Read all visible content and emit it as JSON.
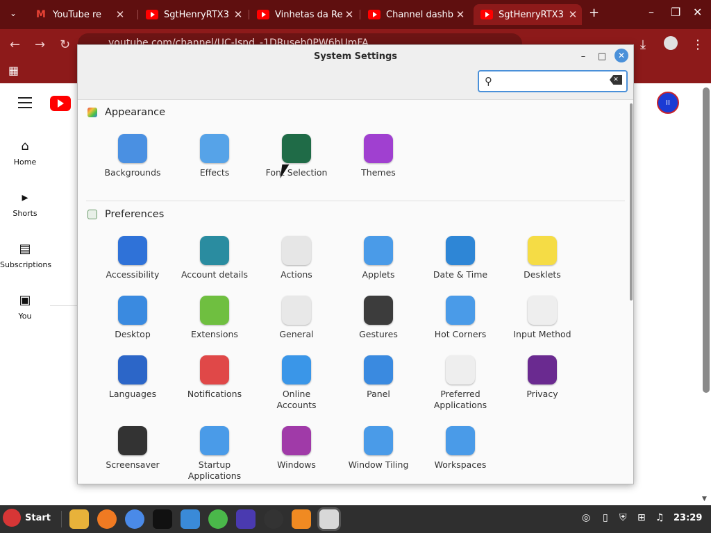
{
  "browser": {
    "tabs": [
      {
        "label": "YouTube re",
        "favicon": "gmail-icon"
      },
      {
        "label": "SgtHenryRTX3",
        "favicon": "youtube-icon"
      },
      {
        "label": "Vinhetas da Re",
        "favicon": "youtube-icon"
      },
      {
        "label": "Channel dashb",
        "favicon": "youtube-icon"
      },
      {
        "label": "SgtHenryRTX3",
        "favicon": "youtube-icon",
        "active": true
      }
    ],
    "address": "youtube.com/channel/UC-Isnd_-1DRuseh0PW6hUmFA"
  },
  "youtube": {
    "nav": [
      {
        "label": "Home",
        "icon": "home-icon"
      },
      {
        "label": "Shorts",
        "icon": "shorts-icon"
      },
      {
        "label": "Subscriptions",
        "icon": "subscriptions-icon"
      },
      {
        "label": "You",
        "icon": "library-icon"
      }
    ]
  },
  "settings": {
    "title": "System Settings",
    "search_value": "",
    "sections": [
      {
        "title": "Appearance",
        "items": [
          {
            "label": "Backgrounds",
            "icon": "backgrounds-icon",
            "color": "#4a90e2"
          },
          {
            "label": "Effects",
            "icon": "effects-icon",
            "color": "#56a3e8"
          },
          {
            "label": "Font Selection",
            "icon": "font-selection-icon",
            "color": "#1f6b47"
          },
          {
            "label": "Themes",
            "icon": "themes-icon",
            "color": "#a040d0"
          }
        ]
      },
      {
        "title": "Preferences",
        "items": [
          {
            "label": "Accessibility",
            "icon": "accessibility-icon",
            "color": "#2f72d8"
          },
          {
            "label": "Account details",
            "icon": "account-details-icon",
            "color": "#2a8ca0"
          },
          {
            "label": "Actions",
            "icon": "actions-icon",
            "color": "#e6e6e6"
          },
          {
            "label": "Applets",
            "icon": "applets-icon",
            "color": "#4a9be8"
          },
          {
            "label": "Date & Time",
            "icon": "date-time-icon",
            "color": "#2e86d6"
          },
          {
            "label": "Desklets",
            "icon": "desklets-icon",
            "color": "#f5dc45"
          },
          {
            "label": "Desktop",
            "icon": "desktop-icon",
            "color": "#3a8ae0"
          },
          {
            "label": "Extensions",
            "icon": "extensions-icon",
            "color": "#6fbf40"
          },
          {
            "label": "General",
            "icon": "general-icon",
            "color": "#e8e8e8"
          },
          {
            "label": "Gestures",
            "icon": "gestures-icon",
            "color": "#3c3c3c"
          },
          {
            "label": "Hot Corners",
            "icon": "hot-corners-icon",
            "color": "#4a9be8"
          },
          {
            "label": "Input Method",
            "icon": "input-method-icon",
            "color": "#eeeeee"
          },
          {
            "label": "Languages",
            "icon": "languages-icon",
            "color": "#2c66c8"
          },
          {
            "label": "Notifications",
            "icon": "notifications-icon",
            "color": "#e04848"
          },
          {
            "label": "Online Accounts",
            "icon": "online-accounts-icon",
            "color": "#3a96e8"
          },
          {
            "label": "Panel",
            "icon": "panel-icon",
            "color": "#3a8ae0"
          },
          {
            "label": "Preferred Applications",
            "icon": "preferred-applications-icon",
            "color": "#eeeeee"
          },
          {
            "label": "Privacy",
            "icon": "privacy-icon",
            "color": "#6a2a90"
          },
          {
            "label": "Screensaver",
            "icon": "screensaver-icon",
            "color": "#333333"
          },
          {
            "label": "Startup Applications",
            "icon": "startup-applications-icon",
            "color": "#4a9be8"
          },
          {
            "label": "Windows",
            "icon": "windows-icon",
            "color": "#a03aa8"
          },
          {
            "label": "Window Tiling",
            "icon": "window-tiling-icon",
            "color": "#4a9be8"
          },
          {
            "label": "Workspaces",
            "icon": "workspaces-icon",
            "color": "#4a9be8"
          }
        ]
      }
    ]
  },
  "taskbar": {
    "start_label": "Start",
    "clock": "23:29"
  }
}
